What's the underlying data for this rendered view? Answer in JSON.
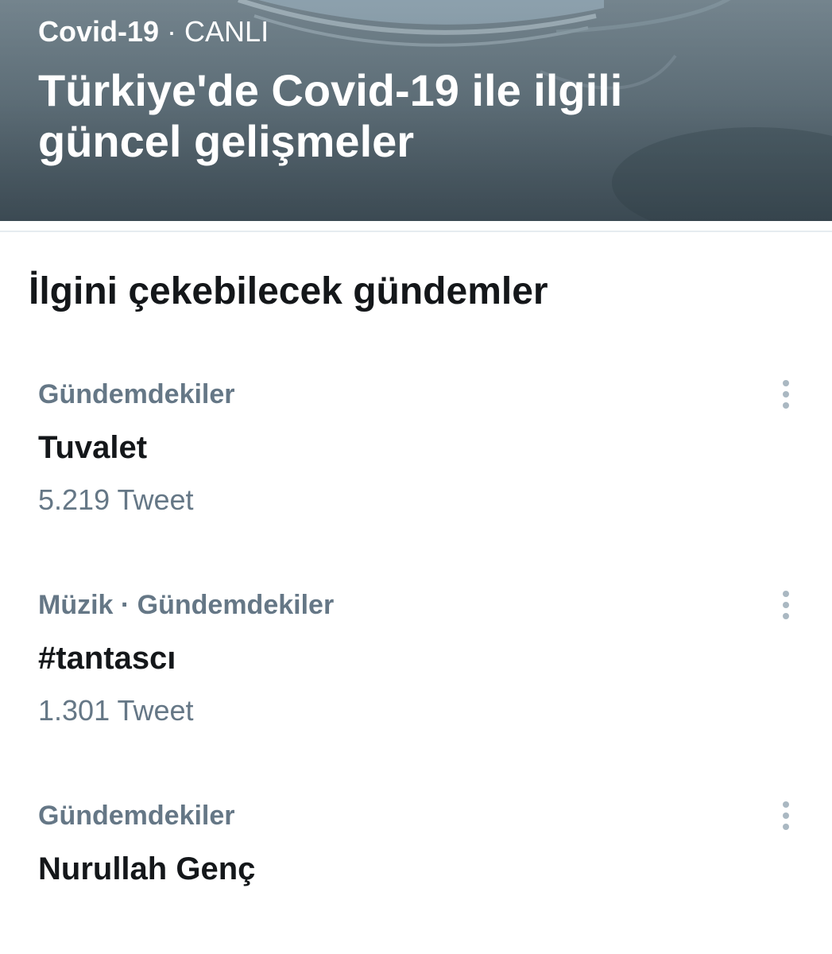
{
  "hero": {
    "category": "Covid-19",
    "separator": "·",
    "status": "CANLI",
    "title": "Türkiye'de Covid-19 ile ilgili güncel gelişmeler"
  },
  "section": {
    "title": "İlgini çekebilecek gündemler"
  },
  "trends": [
    {
      "meta": "Gündemdekiler",
      "name": "Tuvalet",
      "count": "5.219 Tweet",
      "menu_icon": "more-vertical-icon"
    },
    {
      "meta": "Müzik · Gündemdekiler",
      "name": "#tantascı",
      "count": "1.301 Tweet",
      "menu_icon": "more-vertical-icon"
    },
    {
      "meta": "Gündemdekiler",
      "name": "Nurullah Genç",
      "count": "",
      "menu_icon": "more-vertical-icon"
    }
  ],
  "colors": {
    "primary_text": "#14171a",
    "secondary_text": "#657786",
    "menu_dots": "#aab8c2",
    "divider": "#e6ecf0"
  }
}
